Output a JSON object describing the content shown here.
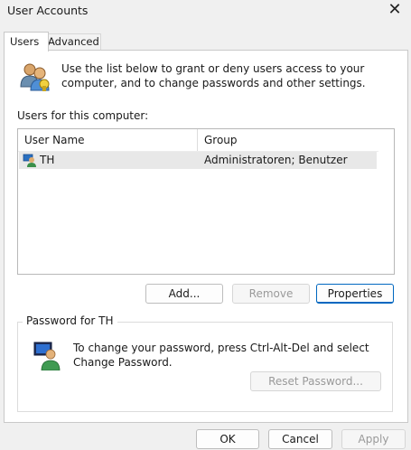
{
  "window": {
    "title": "User Accounts",
    "close_glyph": "✕"
  },
  "tabs": [
    {
      "label": "Users",
      "selected": true
    },
    {
      "label": "Advanced",
      "selected": false
    }
  ],
  "users_tab": {
    "intro": "Use the list below to grant or deny users access to your computer, and to change passwords and other settings.",
    "list_label": "Users for this computer:",
    "columns": [
      "User Name",
      "Group"
    ],
    "rows": [
      {
        "name": "TH",
        "group": "Administratoren; Benutzer",
        "selected": true
      }
    ],
    "buttons": {
      "add": "Add...",
      "remove": "Remove",
      "properties": "Properties"
    }
  },
  "password_group": {
    "title": "Password for TH",
    "text": "To change your password, press Ctrl-Alt-Del and select Change Password.",
    "reset_button": "Reset Password..."
  },
  "dialog_buttons": {
    "ok": "OK",
    "cancel": "Cancel",
    "apply": "Apply"
  },
  "colors": {
    "accent": "#0067c0",
    "selection": "#e8e8e8",
    "panel": "#ffffff",
    "chrome": "#f0f0f0"
  }
}
